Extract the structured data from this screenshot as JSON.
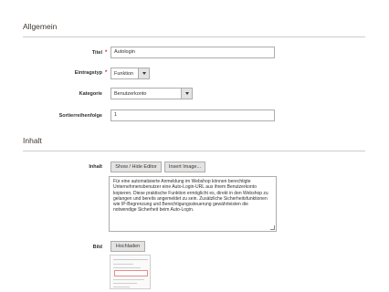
{
  "sections": {
    "general_title": "Allgemein",
    "content_title": "Inhalt"
  },
  "fields": {
    "title": {
      "label": "Titel",
      "required_mark": "*",
      "value": "Autologin"
    },
    "entry_type": {
      "label": "Eintragstyp",
      "required_mark": "*",
      "value": "Funktion"
    },
    "category": {
      "label": "Kategorie",
      "value": "Benutzerkonto"
    },
    "sort_order": {
      "label": "Sortierreihenfolge",
      "value": "1"
    },
    "content": {
      "label": "Inhalt",
      "show_hide_editor": "Show / Hide Editor",
      "insert_image": "Insert Image...",
      "text": "Für eine automatisierte Anmeldung im Webshop können berechtigte Unternehmensbenutzer eine Auto-Login-URL aus ihrem Benutzerkonto kopieren. Diese praktische Funktion ermöglicht es, direkt in den Webshop zu gelangen und bereits angemeldet zu sein. Zusätzliche Sicherheitsfunktionen wie IP-Begrenzung und Berechtigungssteuerung gewährleisten die notwendige Sicherheit beim Auto-Login."
    },
    "image": {
      "label": "Bild",
      "upload_button": "Hochladen"
    }
  },
  "colors": {
    "required": "#e22626",
    "divider": "#cccccc",
    "button_bg": "#e3e3e3",
    "border": "#adadad"
  },
  "icons": {
    "select_arrow": "chevron-down-icon",
    "resize_handle": "resize-grip-icon"
  }
}
